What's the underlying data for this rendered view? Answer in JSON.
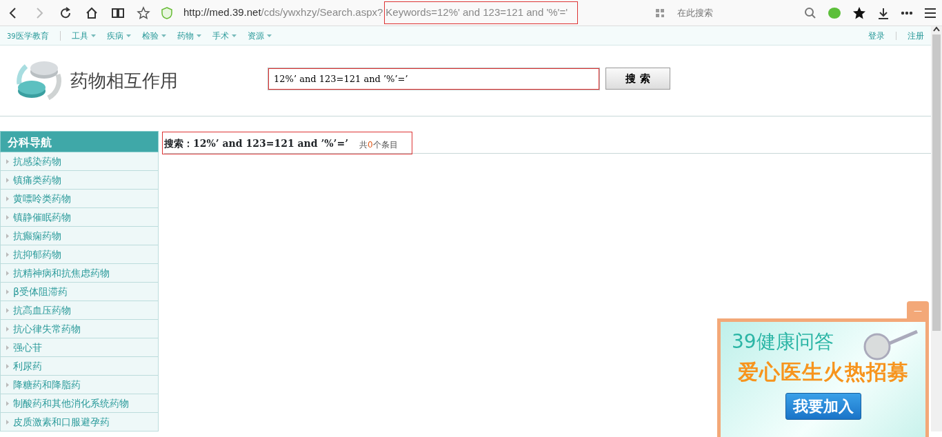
{
  "browser": {
    "url": {
      "scheme": "http://",
      "host": "med.39.net",
      "path": "/cds/ywxhzy/Search.aspx?",
      "query": "Keywords=12%' and 123=121 and '%'='",
      "query_highlighted": true
    },
    "search_placeholder": "在此搜索"
  },
  "topnav": {
    "brand_prefix": "39",
    "brand": "医学教育",
    "menus": [
      "工具",
      "疾病",
      "检验",
      "药物",
      "手术",
      "资源"
    ],
    "links": [
      "登录",
      "注册"
    ]
  },
  "header": {
    "title": "药物相互作用",
    "search_value": "12%’ and 123=121 and ’%’=’",
    "search_highlighted": true,
    "search_button": "搜 索"
  },
  "sidebar": {
    "title": "分科导航",
    "items": [
      "抗感染药物",
      "镇痛类药物",
      "黄嘌呤类药物",
      "镇静催眠药物",
      "抗癫痫药物",
      "抗抑郁药物",
      "抗精神病和抗焦虑药物",
      "β受体阻滞药",
      "抗高血压药物",
      "抗心律失常药物",
      "强心苷",
      "利尿药",
      "降糖药和降脂药",
      "制酸药和其他消化系统药物",
      "皮质激素和口服避孕药"
    ]
  },
  "result": {
    "label": "搜索：",
    "query": "12%’ and 123=121 and ’%’=’",
    "count_before": "共",
    "count": "0",
    "count_after": "个条目",
    "highlighted": true
  },
  "ad": {
    "line1": "39健康问答",
    "line2": "爱心医生火热招募",
    "button": "我要加入",
    "minimize": "—"
  }
}
